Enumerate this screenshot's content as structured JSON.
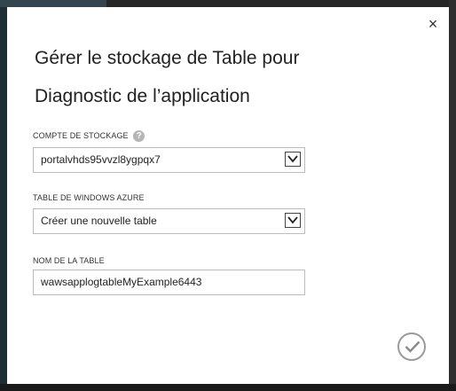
{
  "dialog": {
    "title_line1": "Gérer le stockage de Table pour",
    "title_line2": "Diagnostic de l’application",
    "close_label": "×"
  },
  "storage_account": {
    "label": "COMPTE DE STOCKAGE",
    "help_label": "?",
    "value": "portalvhds95vvzl8ygpqx7"
  },
  "azure_table": {
    "label": "TABLE DE WINDOWS AZURE",
    "value": "Créer une nouvelle table"
  },
  "table_name": {
    "label": "NOM DE LA TABLE",
    "value": "wawsapplogtableMyExample6443"
  },
  "icons": {
    "close": "close-icon",
    "help": "help-icon",
    "dropdown": "chevron-down-icon",
    "confirm": "checkmark-icon"
  }
}
